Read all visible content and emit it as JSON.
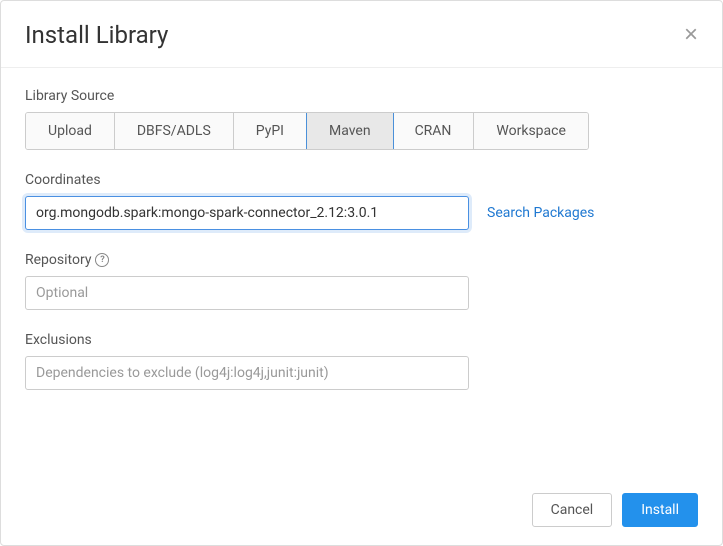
{
  "modal": {
    "title": "Install Library",
    "close_glyph": "×"
  },
  "library_source": {
    "label": "Library Source",
    "tabs": [
      "Upload",
      "DBFS/ADLS",
      "PyPI",
      "Maven",
      "CRAN",
      "Workspace"
    ],
    "active_index": 3
  },
  "coordinates": {
    "label": "Coordinates",
    "value": "org.mongodb.spark:mongo-spark-connector_2.12:3.0.1",
    "search_link": "Search Packages"
  },
  "repository": {
    "label": "Repository",
    "help_glyph": "?",
    "placeholder": "Optional",
    "value": ""
  },
  "exclusions": {
    "label": "Exclusions",
    "placeholder": "Dependencies to exclude (log4j:log4j,junit:junit)",
    "value": ""
  },
  "footer": {
    "cancel": "Cancel",
    "install": "Install"
  }
}
